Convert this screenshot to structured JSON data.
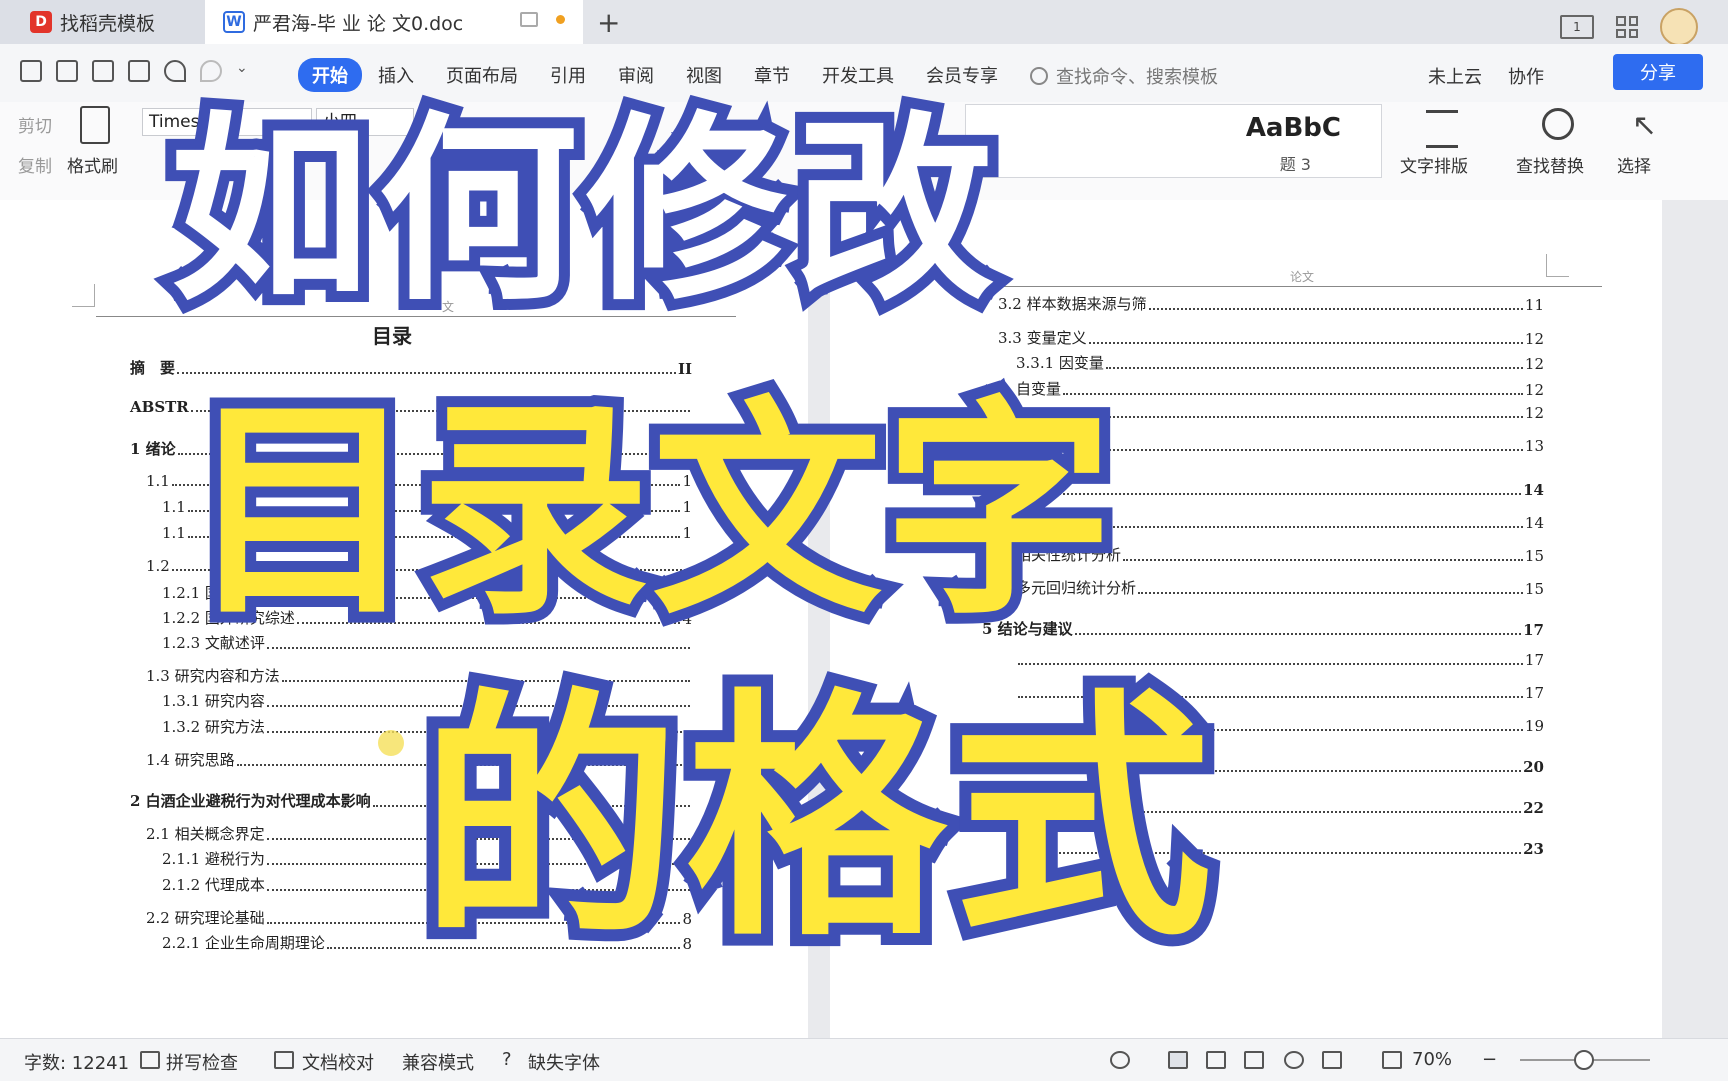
{
  "tabs": [
    {
      "label": "找稻壳模板"
    },
    {
      "label": "严君海-毕 业 论 文0.doc"
    }
  ],
  "menubar": {
    "items": [
      "开始",
      "插入",
      "页面布局",
      "引用",
      "审阅",
      "视图",
      "章节",
      "开发工具",
      "会员专享"
    ],
    "search_placeholder": "查找命令、搜索模板",
    "cloud": "未上云",
    "collab": "协作",
    "share": "分享"
  },
  "ribbon": {
    "cut": "剪切",
    "copy": "复制",
    "format_painter": "格式刷",
    "font": "Times N",
    "size": "小四",
    "style_preview": "AaBbC",
    "style_name": "题 3",
    "text_layout": "文字排版",
    "find_replace": "查找替换",
    "select": "选择"
  },
  "overlay": {
    "line1": "如何修改",
    "line2": "目录文字",
    "line3": "的格式"
  },
  "page_left": {
    "header_text": "文",
    "title": "目录",
    "toc": [
      {
        "label": "摘　要",
        "page": "II",
        "bold": true
      },
      {
        "label": "ABSTR",
        "page": "",
        "bold": true
      },
      {
        "label": "1  绪论",
        "page": "",
        "bold": true
      },
      {
        "label": "1.1",
        "page": "1",
        "bold": false
      },
      {
        "label": "1.1",
        "page": "1",
        "bold": false
      },
      {
        "label": "1.1",
        "page": "1",
        "bold": false
      },
      {
        "label": "1.2",
        "page": "",
        "bold": false
      },
      {
        "label": "1.2.1  国内研究综述",
        "page": "",
        "bold": false
      },
      {
        "label": "1.2.2  国外研究综述",
        "page": "4",
        "bold": false
      },
      {
        "label": "1.2.3  文献述评",
        "page": "",
        "bold": false
      },
      {
        "label": "1.3  研究内容和方法",
        "page": "",
        "bold": false
      },
      {
        "label": "1.3.1  研究内容",
        "page": "",
        "bold": false
      },
      {
        "label": "1.3.2  研究方法",
        "page": "",
        "bold": false
      },
      {
        "label": "1.4  研究思路",
        "page": "",
        "bold": false
      },
      {
        "label": "2    白酒企业避税行为对代理成本影响",
        "page": "",
        "bold": true
      },
      {
        "label": "2.1  相关概念界定",
        "page": "",
        "bold": false
      },
      {
        "label": "2.1.1  避税行为",
        "page": "",
        "bold": false
      },
      {
        "label": "2.1.2  代理成本",
        "page": "",
        "bold": false
      },
      {
        "label": "2.2  研究理论基础",
        "page": "8",
        "bold": false
      },
      {
        "label": "2.2.1  企业生命周期理论",
        "page": "8",
        "bold": false
      }
    ]
  },
  "page_right": {
    "header_text": "论文",
    "toc": [
      {
        "label": "3.2 样本数据来源与筛",
        "page": "11",
        "bold": false
      },
      {
        "label": "3.3 变量定义",
        "page": "12",
        "bold": false
      },
      {
        "label": "3.3.1 因变量",
        "page": "12",
        "bold": false
      },
      {
        "label": "自变量",
        "page": "12",
        "bold": false
      },
      {
        "label": "",
        "page": "12",
        "bold": false
      },
      {
        "label": "",
        "page": "13",
        "bold": false
      },
      {
        "label": "分析",
        "page": "14",
        "bold": true
      },
      {
        "label": "分析",
        "page": "14",
        "bold": false
      },
      {
        "label": "相关性统计分析",
        "page": "15",
        "bold": false
      },
      {
        "label": "多元回归统计分析",
        "page": "15",
        "bold": false
      },
      {
        "label": "5  结论与建议",
        "page": "17",
        "bold": true
      },
      {
        "label": "",
        "page": "17",
        "bold": false
      },
      {
        "label": "",
        "page": "17",
        "bold": false
      },
      {
        "label": "",
        "page": "19",
        "bold": false
      },
      {
        "label": "",
        "page": "20",
        "bold": true
      },
      {
        "label": "",
        "page": "22",
        "bold": true
      },
      {
        "label": "",
        "page": "23",
        "bold": true
      }
    ]
  },
  "statusbar": {
    "word_count": "字数: 12241",
    "spell_check": "拼写检查",
    "doc_proof": "文档校对",
    "compat_mode": "兼容模式",
    "missing_font": "缺失字体",
    "zoom": "70%"
  }
}
